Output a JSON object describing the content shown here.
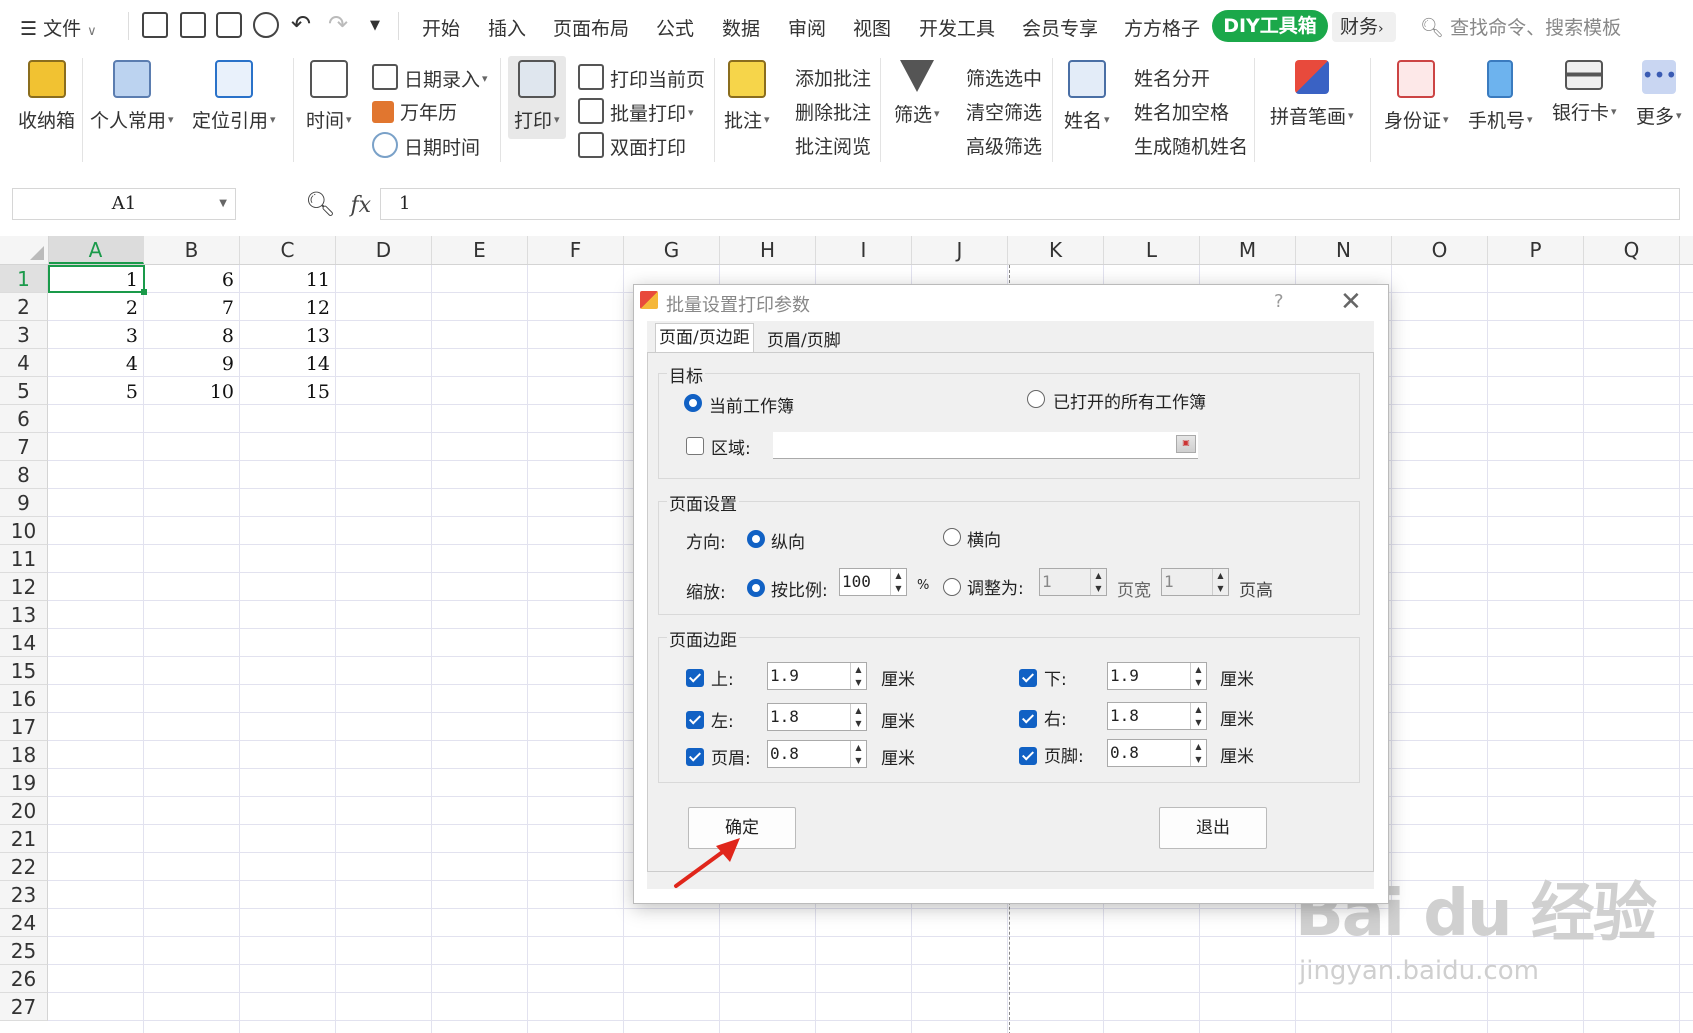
{
  "menubar": {
    "file_label": "文件",
    "tabs": [
      "开始",
      "插入",
      "页面布局",
      "公式",
      "数据",
      "审阅",
      "视图",
      "开发工具",
      "会员专享",
      "方方格子"
    ],
    "active_tab": "DIY工具箱",
    "more_tab": "财务",
    "search_placeholder": "查找命令、搜索模板"
  },
  "ribbon": {
    "storage": "收纳箱",
    "personal": "个人常用",
    "locate_ref": "定位引用",
    "time": "时间",
    "date_entry": "日期录入",
    "calendar": "万年历",
    "datetime": "日期时间",
    "print": "打印",
    "print_current": "打印当前页",
    "batch_print": "批量打印",
    "duplex_print": "双面打印",
    "comment": "批注",
    "add_comment": "添加批注",
    "delete_comment": "删除批注",
    "read_comment": "批注阅览",
    "filter": "筛选",
    "filter_selected": "筛选选中",
    "clear_filter": "清空筛选",
    "advanced_filter": "高级筛选",
    "name": "姓名",
    "split_name": "姓名分开",
    "name_space": "姓名加空格",
    "random_name": "生成随机姓名",
    "pinyin": "拼音笔画",
    "id_card": "身份证",
    "phone": "手机号",
    "bank_card": "银行卡",
    "more": "更多"
  },
  "formula_bar": {
    "cell_ref": "A1",
    "fx": "fx",
    "value": "1"
  },
  "sheet": {
    "columns": [
      "A",
      "B",
      "C",
      "D",
      "E",
      "F",
      "G",
      "H",
      "I",
      "J",
      "K",
      "L",
      "M",
      "N",
      "O",
      "P",
      "Q"
    ],
    "rows": [
      "1",
      "2",
      "3",
      "4",
      "5",
      "6",
      "7",
      "8",
      "9",
      "10",
      "11",
      "12",
      "13",
      "14",
      "15",
      "16",
      "17",
      "18",
      "19",
      "20",
      "21",
      "22",
      "23",
      "24",
      "25",
      "26",
      "27"
    ],
    "data": [
      [
        "1",
        "6",
        "11"
      ],
      [
        "2",
        "7",
        "12"
      ],
      [
        "3",
        "8",
        "13"
      ],
      [
        "4",
        "9",
        "14"
      ],
      [
        "5",
        "10",
        "15"
      ]
    ]
  },
  "dialog": {
    "title": "批量设置打印参数",
    "help": "?",
    "close": "✕",
    "tabs": [
      "页面/页边距",
      "页眉/页脚"
    ],
    "target": {
      "title": "目标",
      "current_workbook": "当前工作簿",
      "all_open_workbooks": "已打开的所有工作簿",
      "range_label": "区域:",
      "range_value": ""
    },
    "page_setup": {
      "title": "页面设置",
      "orientation_label": "方向:",
      "portrait": "纵向",
      "landscape": "横向",
      "scale_label": "缩放:",
      "by_ratio": "按比例:",
      "ratio_value": "100",
      "percent": "%",
      "fit_to": "调整为:",
      "pages_wide_value": "1",
      "pages_wide": "页宽",
      "pages_tall_value": "1",
      "pages_tall": "页高"
    },
    "margins": {
      "title": "页面边距",
      "top_label": "上:",
      "top_value": "1.9",
      "bottom_label": "下:",
      "bottom_value": "1.9",
      "left_label": "左:",
      "left_value": "1.8",
      "right_label": "右:",
      "right_value": "1.8",
      "header_label": "页眉:",
      "header_value": "0.8",
      "footer_label": "页脚:",
      "footer_value": "0.8",
      "unit": "厘米"
    },
    "ok": "确定",
    "exit": "退出"
  },
  "watermark": {
    "top": "Bai du 经验",
    "bottom": "jingyan.baidu.com"
  }
}
